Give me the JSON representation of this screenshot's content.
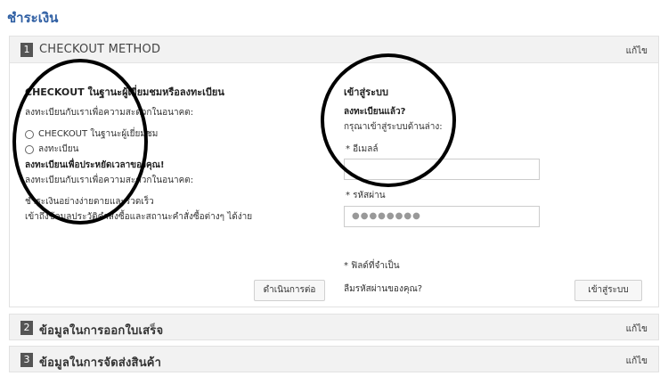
{
  "page": {
    "title": "ชำระเงิน"
  },
  "step1": {
    "number": "1",
    "title": "CHECKOUT METHOD",
    "edit": "แก้ไข",
    "left": {
      "heading": "CHECKOUT ในฐานะผู้เยี่ยมชมหรือลงทะเบียน",
      "subtext": "ลงทะเบียนกับเราเพื่อความสะดวกในอนาคต:",
      "options": [
        "CHECKOUT ในฐานะผู้เยี่ยมชม",
        "ลงทะเบียน"
      ],
      "save_heading": "ลงทะเบียนเพื่อประหยัดเวลาของคุณ!",
      "save_subtext": "ลงทะเบียนกับเราเพื่อความสะดวกในอนาคต:",
      "benefit1": "ชำระเงินอย่างง่ายดายและรวดเร็ว",
      "benefit2": "เข้าถึงข้อมูลประวัติคำสั่งซื้อและสถานะคำสั่งซื้อต่างๆ ได้ง่าย",
      "continue_button": "ดำเนินการต่อ"
    },
    "right": {
      "heading": "เข้าสู่ระบบ",
      "registered": "ลงทะเบียนแล้ว?",
      "please_login": "กรุณาเข้าสู่ระบบด้านล่าง:",
      "email_label": "* อีเมลล์",
      "password_label": "* รหัสผ่าน",
      "password_value": "●●●●●●●●",
      "required_note": "* ฟิลด์ที่จำเป็น",
      "forgot": "ลืมรหัสผ่านของคุณ?",
      "login_button": "เข้าสู่ระบบ"
    }
  },
  "step2": {
    "number": "2",
    "title": "ข้อมูลในการออกใบเสร็จ",
    "edit": "แก้ไข"
  },
  "step3": {
    "number": "3",
    "title": "ข้อมูลในการจัดส่งสินค้า",
    "edit": "แก้ไข"
  }
}
